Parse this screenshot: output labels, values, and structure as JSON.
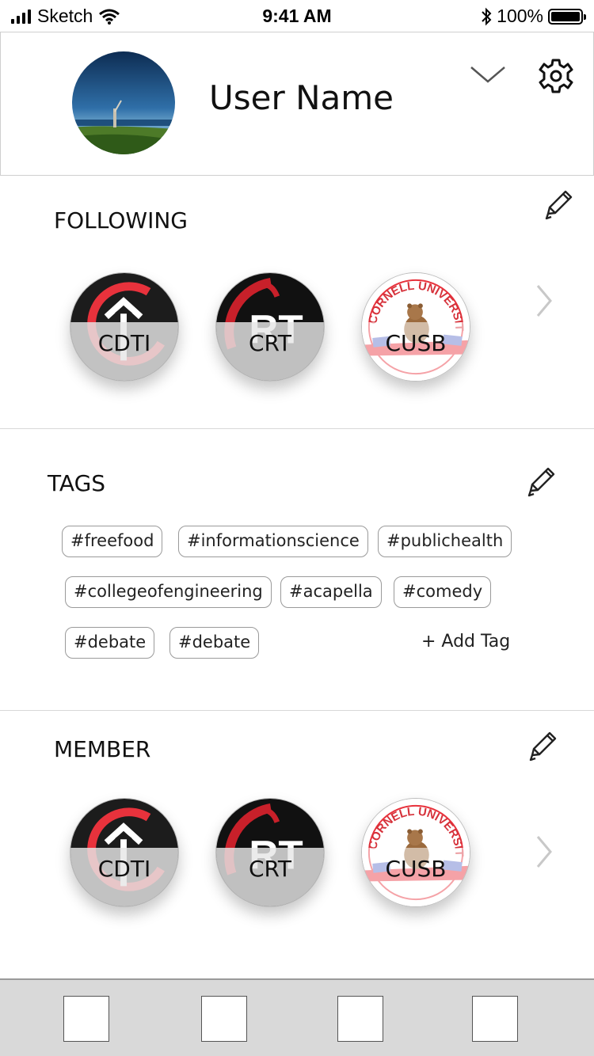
{
  "status_bar": {
    "carrier": "Sketch",
    "time": "9:41 AM",
    "battery": "100%"
  },
  "profile": {
    "username": "User Name",
    "icons": [
      "avatar-photo",
      "chevron-down-icon",
      "gear-icon"
    ]
  },
  "following": {
    "title": "FOLLOWING",
    "orgs": [
      {
        "label": "CDTI",
        "logo": "cdti-logo"
      },
      {
        "label": "CRT",
        "logo": "crt-logo"
      },
      {
        "label": "CUSB",
        "logo": "cusb-logo"
      }
    ]
  },
  "tags": {
    "title": "TAGS",
    "items": [
      "#freefood",
      "#informationscience",
      "#publichealth",
      "#collegeofengineering",
      "#acapella",
      "#comedy",
      "#debate",
      "#debate"
    ],
    "add_label": "+ Add Tag"
  },
  "member": {
    "title": "MEMBER",
    "orgs": [
      {
        "label": "CDTI",
        "logo": "cdti-logo"
      },
      {
        "label": "CRT",
        "logo": "crt-logo"
      },
      {
        "label": "CUSB",
        "logo": "cusb-logo"
      }
    ]
  },
  "logo_text": {
    "crt": "RT",
    "cusb": "CORNELL UNIVERSITY"
  },
  "tab_bar": {
    "tab_count": 4
  },
  "colors": {
    "accent_red": "#e8323c",
    "logo_dark": "#1c1c1c",
    "tab_bar_bg": "#d9d9d9",
    "divider": "#d8d8d8"
  }
}
